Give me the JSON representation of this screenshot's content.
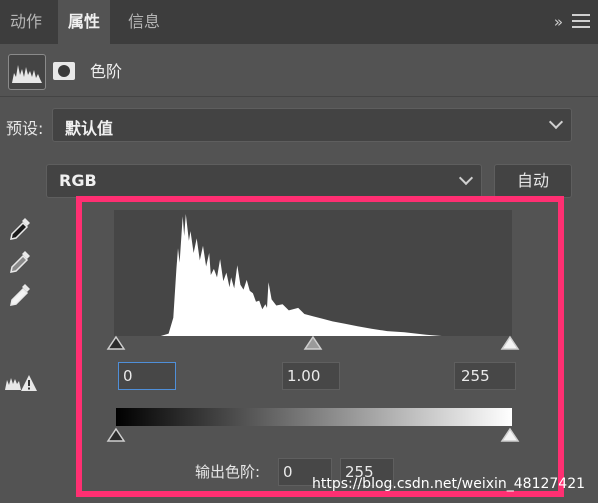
{
  "tabs": [
    {
      "label": "动作",
      "active": false
    },
    {
      "label": "属性",
      "active": true
    },
    {
      "label": "信息",
      "active": false
    }
  ],
  "panel": {
    "collapse_glyph": "»",
    "title": "色阶",
    "icons": [
      "levels-adjustment-icon",
      "mask-icon"
    ]
  },
  "preset": {
    "label": "预设:",
    "value": "默认值"
  },
  "channel": {
    "value": "RGB"
  },
  "auto_button": "自动",
  "tools": [
    "black-point-eyedropper-icon",
    "gray-point-eyedropper-icon",
    "white-point-eyedropper-icon",
    "clipping-warning-icon"
  ],
  "input_levels": {
    "black": "0",
    "gamma": "1.00",
    "white": "255"
  },
  "output_levels": {
    "label": "输出色阶:",
    "black": "0",
    "white": "255"
  },
  "histogram": {
    "x_range": [
      0,
      255
    ],
    "points": [
      [
        0,
        0
      ],
      [
        30,
        0
      ],
      [
        35,
        2
      ],
      [
        38,
        15
      ],
      [
        40,
        55
      ],
      [
        41,
        72
      ],
      [
        42,
        60
      ],
      [
        44,
        98
      ],
      [
        45,
        82
      ],
      [
        46,
        100
      ],
      [
        48,
        78
      ],
      [
        49,
        86
      ],
      [
        51,
        68
      ],
      [
        53,
        80
      ],
      [
        55,
        62
      ],
      [
        57,
        74
      ],
      [
        59,
        57
      ],
      [
        61,
        68
      ],
      [
        62,
        50
      ],
      [
        64,
        55
      ],
      [
        66,
        48
      ],
      [
        68,
        63
      ],
      [
        70,
        45
      ],
      [
        72,
        52
      ],
      [
        74,
        40
      ],
      [
        75,
        48
      ],
      [
        77,
        39
      ],
      [
        79,
        58
      ],
      [
        81,
        42
      ],
      [
        83,
        38
      ],
      [
        85,
        46
      ],
      [
        87,
        37
      ],
      [
        89,
        35
      ],
      [
        91,
        28
      ],
      [
        93,
        29
      ],
      [
        95,
        22
      ],
      [
        97,
        26
      ],
      [
        98,
        23
      ],
      [
        99,
        44
      ],
      [
        101,
        30
      ],
      [
        104,
        25
      ],
      [
        108,
        26
      ],
      [
        112,
        21
      ],
      [
        118,
        23
      ],
      [
        122,
        18
      ],
      [
        128,
        16
      ],
      [
        134,
        14
      ],
      [
        140,
        12
      ],
      [
        148,
        10
      ],
      [
        156,
        8
      ],
      [
        165,
        6
      ],
      [
        175,
        4
      ],
      [
        186,
        3
      ],
      [
        200,
        1
      ],
      [
        210,
        0
      ],
      [
        255,
        0
      ]
    ]
  },
  "colors": {
    "panel_bg": "#535353",
    "tab_bar_bg": "#3d3d3d",
    "highlight": "#ff2f72",
    "focus": "#4f8fd9"
  },
  "watermark": "https://blog.csdn.net/weixin_48127421"
}
